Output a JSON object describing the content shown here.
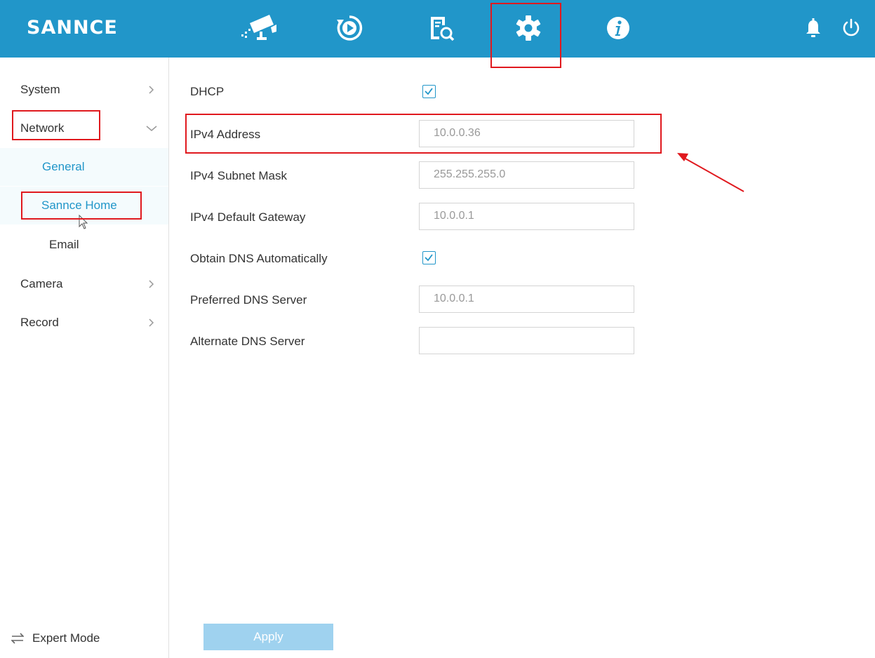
{
  "app": {
    "logo": "SANNCE"
  },
  "topnav": {
    "items": [
      {
        "icon": "live-view-camera-icon"
      },
      {
        "icon": "playback-icon"
      },
      {
        "icon": "search-icon"
      },
      {
        "icon": "settings-gear-icon",
        "active": true
      },
      {
        "icon": "info-icon"
      }
    ],
    "right": [
      {
        "icon": "bell-icon"
      },
      {
        "icon": "power-icon"
      }
    ]
  },
  "sidebar": {
    "items": [
      {
        "label": "System",
        "state": "collapsed"
      },
      {
        "label": "Network",
        "state": "expanded",
        "children": [
          "General",
          "Sannce Home",
          "Email"
        ]
      },
      {
        "label": "Camera",
        "state": "collapsed"
      },
      {
        "label": "Record",
        "state": "collapsed"
      }
    ],
    "expert_mode_label": "Expert Mode"
  },
  "form": {
    "dhcp": {
      "label": "DHCP",
      "checked": true
    },
    "ipv4_address": {
      "label": "IPv4 Address",
      "value": "10.0.0.36"
    },
    "ipv4_subnet_mask": {
      "label": "IPv4 Subnet Mask",
      "value": "255.255.255.0"
    },
    "ipv4_default_gateway": {
      "label": "IPv4 Default Gateway",
      "value": "10.0.0.1"
    },
    "obtain_dns": {
      "label": "Obtain DNS Automatically",
      "checked": true
    },
    "preferred_dns": {
      "label": "Preferred DNS Server",
      "value": "10.0.0.1"
    },
    "alternate_dns": {
      "label": "Alternate DNS Server",
      "value": ""
    },
    "apply_label": "Apply"
  },
  "colors": {
    "accent": "#2196c9",
    "annotation": "#e0191e",
    "apply_disabled": "#9fd2ef"
  }
}
